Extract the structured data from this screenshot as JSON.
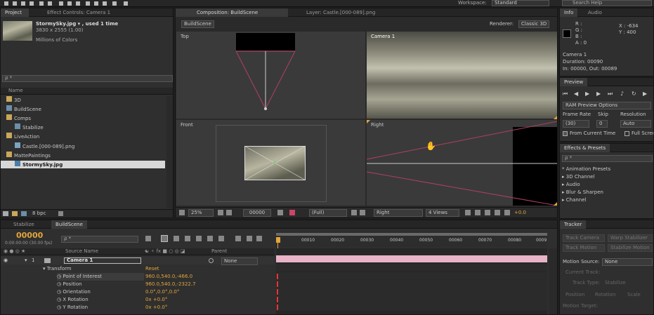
{
  "topbar": {
    "workspace_label": "Workspace:",
    "workspace_value": "Standard",
    "search_placeholder": "Search Help"
  },
  "project_panel": {
    "tabs": [
      "Project",
      "Effect Controls: Camera 1"
    ],
    "asset_name": "StormySky.jpg ▾ , used 1 time",
    "asset_dims": "3830 x 2555 (1.00)",
    "asset_colors": "Millions of Colors",
    "search_placeholder": "ρ *",
    "column_name": "Name",
    "items": [
      {
        "label": "3D",
        "type": "folder",
        "indent": 0
      },
      {
        "label": "BuildScene",
        "type": "comp",
        "indent": 1
      },
      {
        "label": "Comps",
        "type": "folder",
        "indent": 0
      },
      {
        "label": "Stabilize",
        "type": "comp",
        "indent": 1
      },
      {
        "label": "LiveAction",
        "type": "folder",
        "indent": 0
      },
      {
        "label": "Castle.[000-089].png",
        "type": "footage",
        "indent": 1
      },
      {
        "label": "MattePaintings",
        "type": "folder",
        "indent": 0
      },
      {
        "label": "StormySky.jpg",
        "type": "image",
        "indent": 1,
        "selected": true
      }
    ],
    "bpc": "8 bpc"
  },
  "composition_panel": {
    "tabs": [
      "Composition: BuildScene",
      "Layer: Castle.[000-089].png"
    ],
    "comp_button": "BuildScene",
    "renderer_label": "Renderer:",
    "renderer_value": "Classic 3D",
    "views": {
      "top": "Top",
      "camera": "Camera 1",
      "front": "Front",
      "right": "Right"
    },
    "footer": {
      "zoom": "25%",
      "timecode": "00000",
      "resolution": "(Full)",
      "view": "Right",
      "layout": "4 Views",
      "exposure": "+0.0"
    }
  },
  "info_panel": {
    "tabs": [
      "Info",
      "Audio"
    ],
    "rgba": {
      "r": "R :",
      "g": "G :",
      "b": "B :",
      "a": "A : 0"
    },
    "x": "X : -634",
    "y": "Y : 400",
    "camera_name": "Camera 1",
    "duration": "Duration: 00090",
    "in_out": "In: 00000, Out: 00089"
  },
  "preview_panel": {
    "title": "Preview",
    "ram_preview": "RAM Preview Options",
    "frame_rate_label": "Frame Rate",
    "skip_label": "Skip",
    "resolution_label": "Resolution",
    "frame_rate_value": "(30)",
    "skip_value": "0",
    "resolution_value": "Auto",
    "from_current_time": "From Current Time",
    "full_screen": "Full Scree"
  },
  "effects_panel": {
    "title": "Effects & Presets",
    "search_placeholder": "ρ *",
    "items": [
      "* Animation Presets",
      "3D Channel",
      "Audio",
      "Blur & Sharpen",
      "Channel"
    ]
  },
  "timeline_panel": {
    "tabs": [
      "Stabilize",
      "BuildScene"
    ],
    "timecode": "00000",
    "timecode_sub": "0:00:00:00 (30.00 fps)",
    "search_placeholder": "ρ *",
    "col_source": "Source Name",
    "col_parent": "Parent",
    "layer": {
      "num": "1",
      "name": "Camera 1",
      "parent": "None"
    },
    "transform_label": "Transform",
    "reset_label": "Reset",
    "properties": [
      {
        "name": "Point of Interest",
        "value": "960.0,540.0,-466.0"
      },
      {
        "name": "Position",
        "value": "960.0,540.0,-2322.7"
      },
      {
        "name": "Orientation",
        "value": "0.0°,0.0°,0.0°"
      },
      {
        "name": "X Rotation",
        "value": "0x +0.0°"
      },
      {
        "name": "Y Rotation",
        "value": "0x +0.0°"
      }
    ],
    "ruler_ticks": [
      "00010",
      "00020",
      "00030",
      "00040",
      "00050",
      "00060",
      "00070",
      "00080",
      "0009"
    ]
  },
  "tracker_panel": {
    "title": "Tracker",
    "rows": [
      "Track Camera",
      "Warp Stabilizer",
      "Track Motion",
      "Stabilize Motion"
    ],
    "motion_source_label": "Motion Source:",
    "motion_source_value": "None",
    "current_track_label": "Current Track:",
    "track_type_label": "Track Type:",
    "track_type_value": "Stabilize",
    "position_label": "Position",
    "rotation_label": "Rotation",
    "scale_label": "Scale",
    "motion_target_label": "Motion Target:"
  },
  "colors": {
    "accent": "#e3a63a",
    "selection": "#4a5f7a",
    "pink_track": "#e8b3c7",
    "red_keyframe": "#e33333"
  }
}
